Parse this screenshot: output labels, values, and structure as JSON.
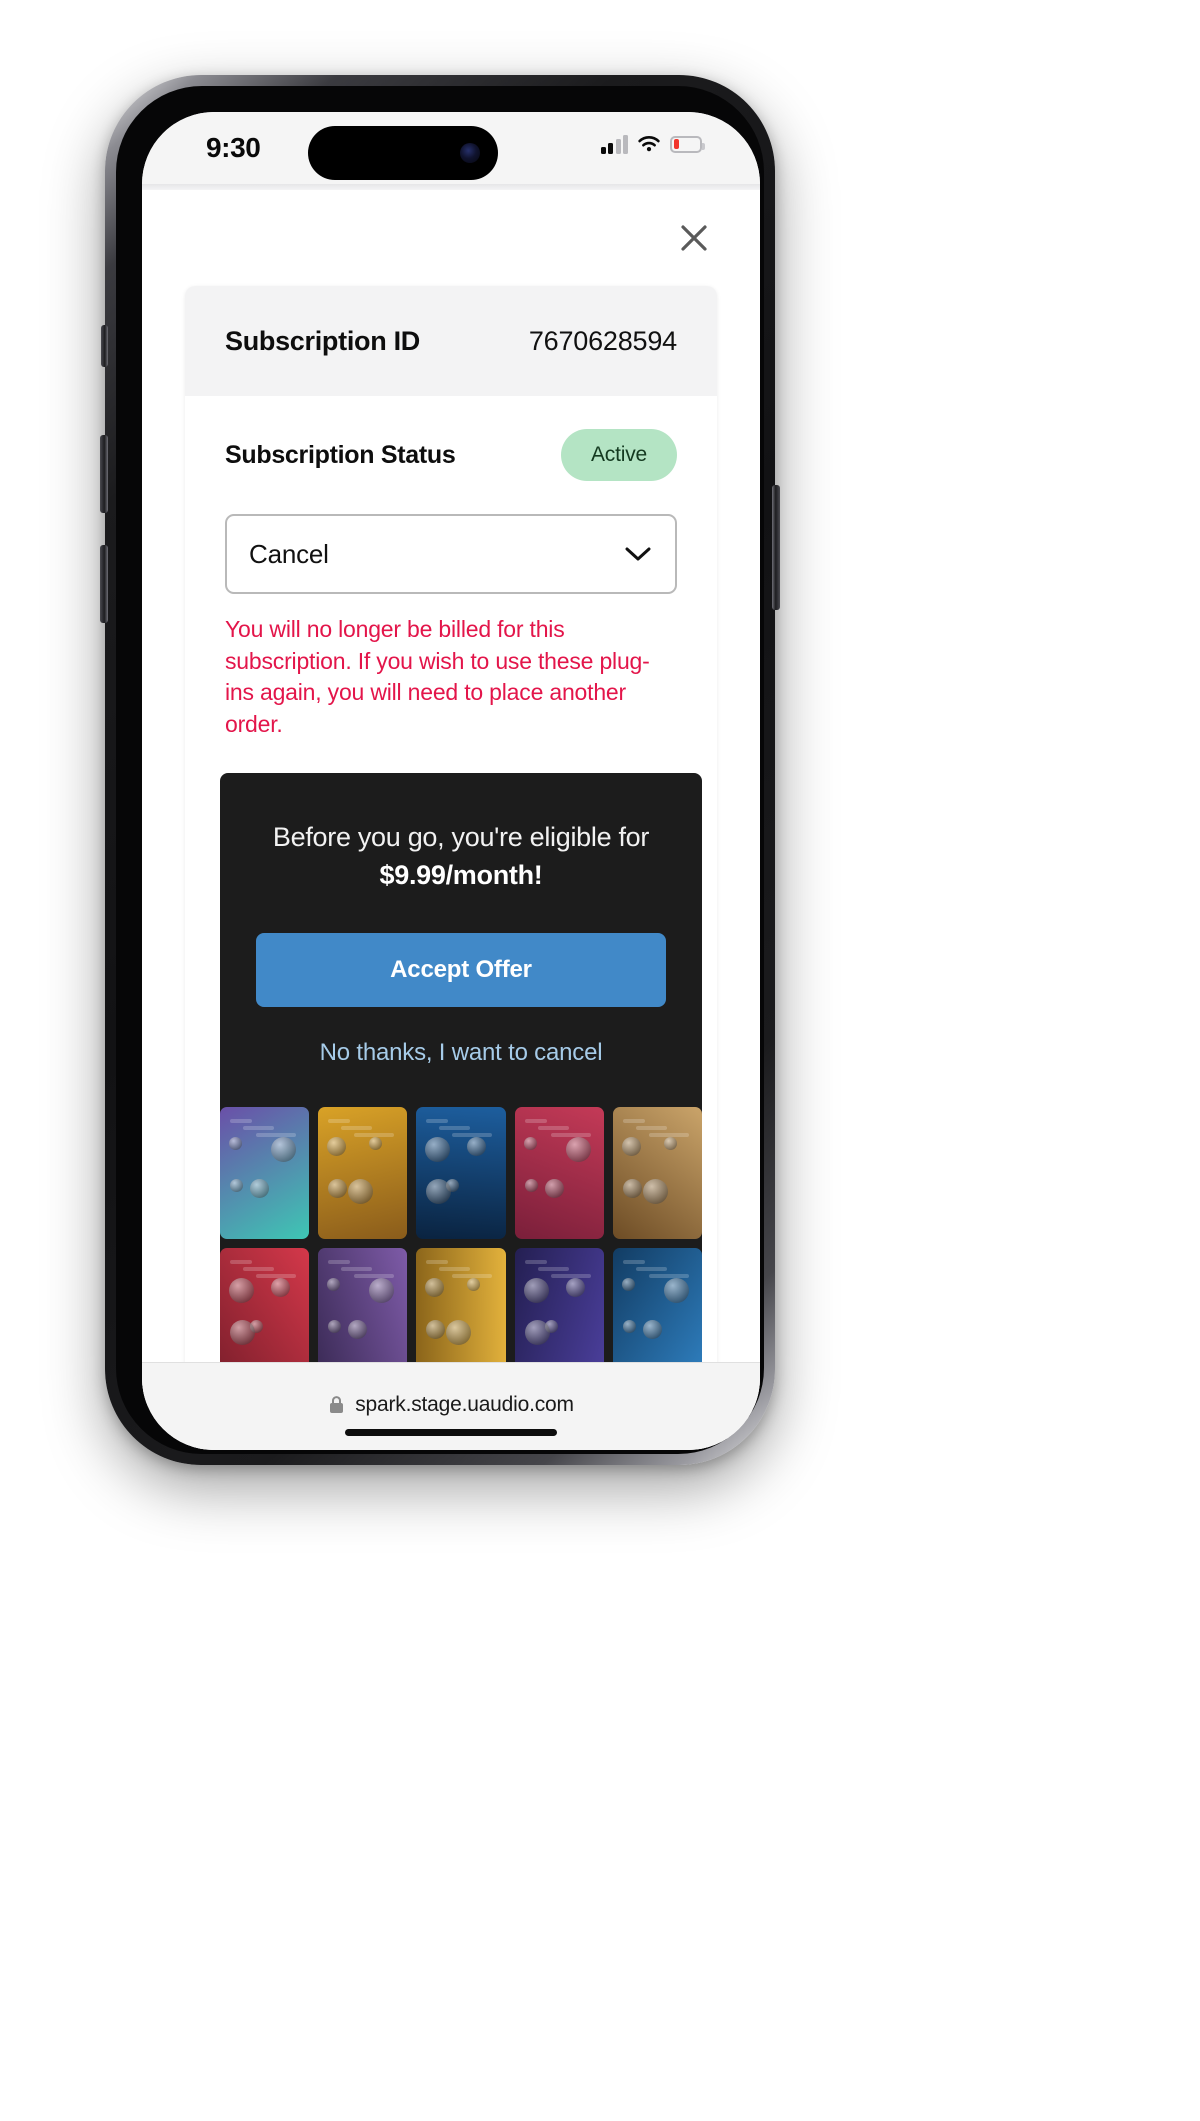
{
  "status_bar": {
    "time": "9:30",
    "signal_icon": "cellular-signal-icon",
    "signal_bars_active": 2,
    "wifi_icon": "wifi-icon",
    "battery_icon": "battery-low-icon",
    "battery_color": "#f2352c"
  },
  "page": {
    "close_icon": "close-x-icon",
    "subscription": {
      "id_label": "Subscription ID",
      "id_value": "7670628594",
      "status_label": "Subscription Status",
      "status_badge": "Active",
      "status_badge_bg": "#b4e4c4",
      "status_badge_color": "#143a20"
    },
    "action_select": {
      "value": "Cancel",
      "chevron_icon": "chevron-down-icon",
      "options": [
        "Cancel"
      ]
    },
    "cancel_warning": "You will no longer be billed for this subscription. If you wish to use these plug-ins again, you will need to place another order.",
    "cancel_warning_color": "#e3154a",
    "offer": {
      "heading_prefix": "Before you go, you're eligible for ",
      "heading_price": "$9.99/month!",
      "heading_full": "Before you go, you're eligible for $9.99/month!",
      "accept_label": "Accept Offer",
      "accept_color": "#4189c8",
      "decline_label": "No thanks, I want to cancel",
      "decline_color": "#a6cbe8",
      "panel_bg": "#1c1c1c",
      "plugins": [
        {
          "name": "plugin-thumb-1",
          "c1": "#6a4fa8",
          "c2": "#3ec7b4"
        },
        {
          "name": "plugin-thumb-2",
          "c1": "#d9a227",
          "c2": "#8a5c1b"
        },
        {
          "name": "plugin-thumb-3",
          "c1": "#1d5e9e",
          "c2": "#0a2340"
        },
        {
          "name": "plugin-thumb-4",
          "c1": "#c43a57",
          "c2": "#7a1f3a"
        },
        {
          "name": "plugin-thumb-5",
          "c1": "#caa46a",
          "c2": "#6d4c25"
        },
        {
          "name": "plugin-thumb-6",
          "c1": "#d4384a",
          "c2": "#7d1f2c"
        },
        {
          "name": "plugin-thumb-7",
          "c1": "#7e5ba8",
          "c2": "#3a2a55"
        },
        {
          "name": "plugin-thumb-8",
          "c1": "#e3b23c",
          "c2": "#8a641a"
        },
        {
          "name": "plugin-thumb-9",
          "c1": "#4b3f9c",
          "c2": "#241f52"
        },
        {
          "name": "plugin-thumb-10",
          "c1": "#2f7fbf",
          "c2": "#123c63"
        }
      ]
    }
  },
  "browser": {
    "lock_icon": "lock-icon",
    "url": "spark.stage.uaudio.com"
  }
}
